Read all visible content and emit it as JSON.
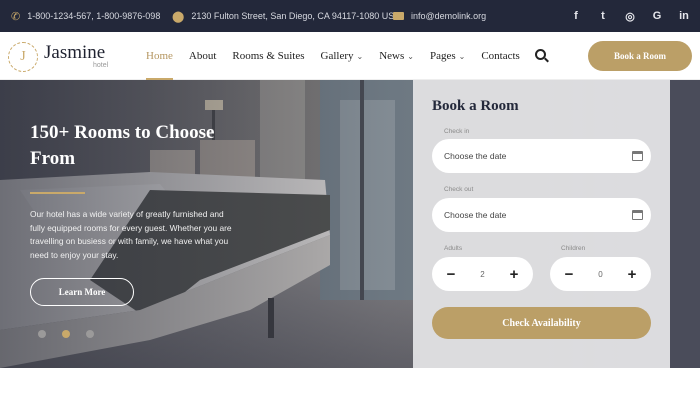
{
  "topbar": {
    "phones": "1-800-1234-567,  1-800-9876-098",
    "address": "2130 Fulton Street, San Diego, CA 94117-1080 USA",
    "email": "info@demolink.org",
    "socials": [
      {
        "icon": "facebook-icon",
        "glyph": "f"
      },
      {
        "icon": "twitter-icon",
        "glyph": "t"
      },
      {
        "icon": "instagram-icon",
        "glyph": "◎"
      },
      {
        "icon": "google-icon",
        "glyph": "G"
      },
      {
        "icon": "linkedin-icon",
        "glyph": "in"
      }
    ]
  },
  "header": {
    "logo_letter": "J",
    "logo_name": "Jasmine",
    "logo_sub": "hotel",
    "nav": [
      {
        "label": "Home",
        "active": true,
        "dropdown": false
      },
      {
        "label": "About",
        "active": false,
        "dropdown": false
      },
      {
        "label": "Rooms & Suites",
        "active": false,
        "dropdown": false
      },
      {
        "label": "Gallery",
        "active": false,
        "dropdown": true
      },
      {
        "label": "News",
        "active": false,
        "dropdown": true
      },
      {
        "label": "Pages",
        "active": false,
        "dropdown": true
      },
      {
        "label": "Contacts",
        "active": false,
        "dropdown": false
      }
    ],
    "book_button": "Book a Room"
  },
  "hero": {
    "title": "150+ Rooms to Choose From",
    "text": "Our hotel has a wide variety of greatly furnished and fully equipped rooms for every guest. Whether you are travelling on busiess or with family, we have what you need to enjoy your stay.",
    "button": "Learn More",
    "slides": 3,
    "active_slide": 2
  },
  "booking": {
    "title": "Book a Room",
    "checkin_label": "Check in",
    "checkin_placeholder": "Choose the date",
    "checkout_label": "Check out",
    "checkout_placeholder": "Choose the date",
    "adults_label": "Adults",
    "adults_value": "2",
    "children_label": "Children",
    "children_value": "0",
    "submit": "Check Availability"
  },
  "colors": {
    "accent": "#bb9f67",
    "topbar": "#23283a"
  }
}
